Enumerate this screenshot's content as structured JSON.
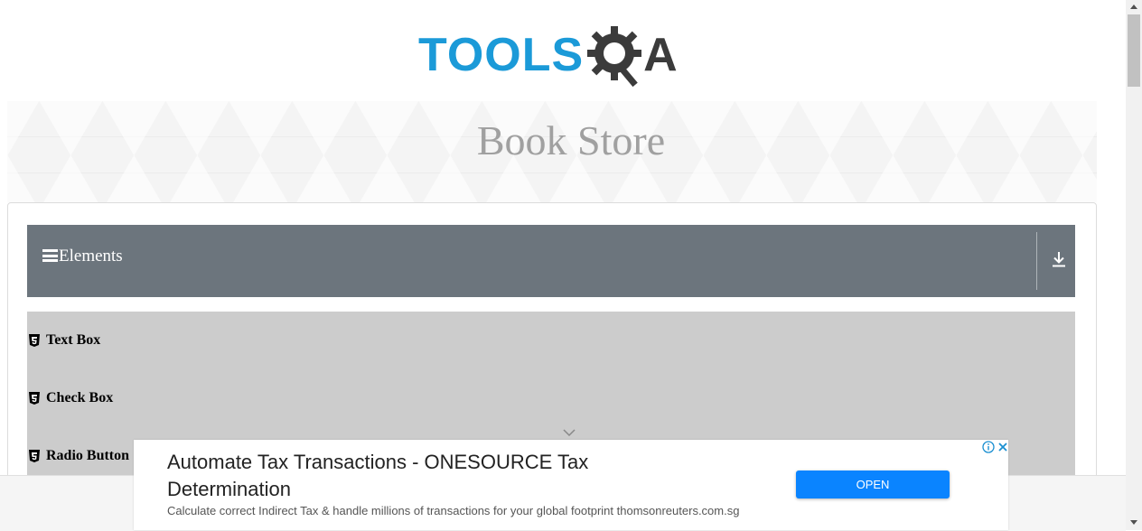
{
  "logo": {
    "text_left": "TOOLS",
    "text_right": "A",
    "icon": "gear-magnifier-icon",
    "brand_color": "#1b9ad8",
    "dark_color": "#3b3b3b"
  },
  "banner": {
    "title": "Book Store"
  },
  "group": {
    "title": "Elements",
    "menu_icon": "hamburger-icon",
    "toggle_icon": "download-arrow-icon",
    "header_color": "#6c757d"
  },
  "elements": [
    {
      "label": "Text Box",
      "icon": "html5-icon"
    },
    {
      "label": "Check Box",
      "icon": "html5-icon"
    },
    {
      "label": "Radio Button",
      "icon": "html5-icon"
    }
  ],
  "ad": {
    "title": "Automate Tax Transactions - ONESOURCE Tax Determination",
    "description": "Calculate correct Indirect Tax & handle millions of transactions for your global footprint thomsonreuters.com.sg",
    "button_label": "OPEN",
    "button_color": "#0a84ff"
  }
}
